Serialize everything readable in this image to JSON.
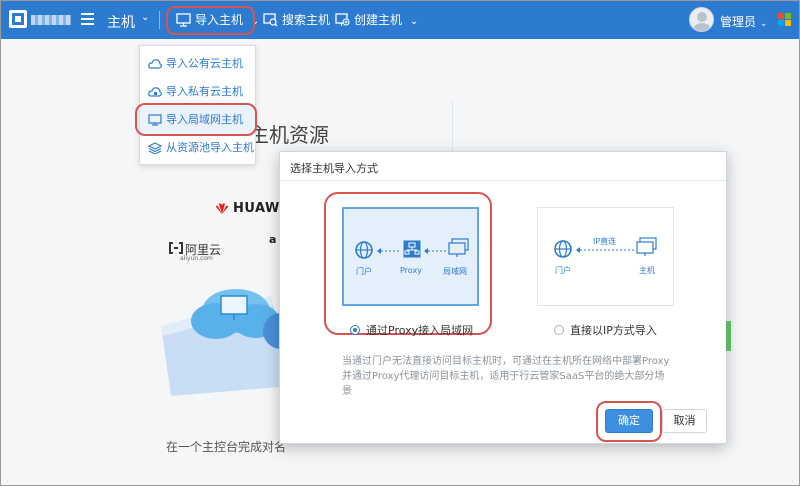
{
  "topbar": {
    "section_label": "主机",
    "import_label": "导入主机",
    "search_label": "搜索主机",
    "create_label": "创建主机",
    "user_name": "管理员",
    "colors": {
      "bar": "#2d7bd0",
      "highlight": "#d9534f"
    }
  },
  "dropdown": {
    "items": [
      {
        "label": "导入公有云主机",
        "icon": "cloud-icon"
      },
      {
        "label": "导入私有云主机",
        "icon": "cloud-icon"
      },
      {
        "label": "导入局域网主机",
        "icon": "monitor-icon"
      },
      {
        "label": "从资源池导入主机",
        "icon": "layers-icon"
      }
    ]
  },
  "background": {
    "title": "主机资源",
    "huawei": "HUAWE",
    "aliyun": "阿里云",
    "aliyun_sub": "aliyun.com",
    "amazon": "a",
    "bottom_text": "在一个主控台完成对名"
  },
  "dialog": {
    "title": "选择主机导入方式",
    "proxy_card": {
      "portal": "门户",
      "proxy": "Proxy",
      "lan": "局域网"
    },
    "ip_card": {
      "portal": "门户",
      "ip_direct": "IP直连",
      "host": "主机"
    },
    "option_proxy": "通过Proxy接入局域网",
    "option_ip": "直接以IP方式导入",
    "description": "当通过门户无法直接访问目标主机时，可通过在主机所在网络中部署Proxy并通过Proxy代理访问目标主机，适用于行云管家SaaS平台的绝大部分场景",
    "confirm": "确定",
    "cancel": "取消"
  }
}
